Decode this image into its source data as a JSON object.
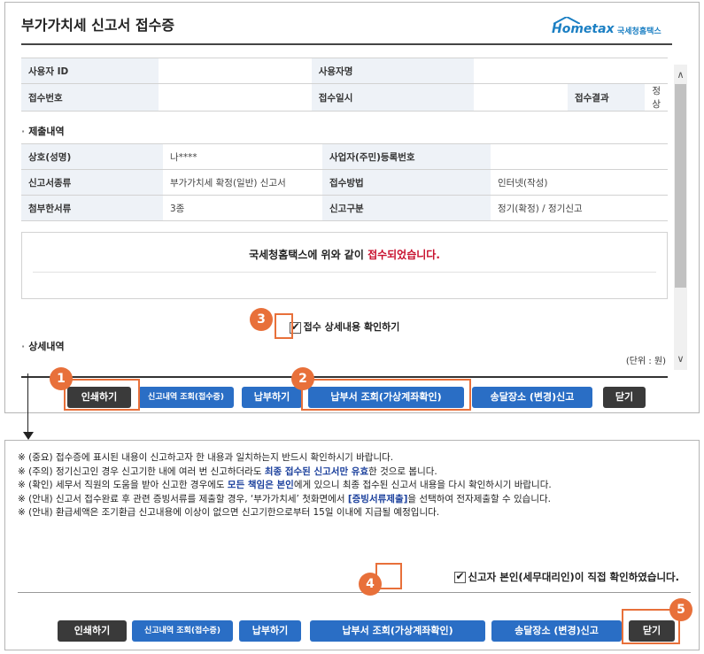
{
  "header": {
    "title": "부가가치세 신고서 접수증",
    "logo_main": "Hometax",
    "logo_sub": "국세청홈택스"
  },
  "user_table": [
    [
      {
        "t": "사용자 ID",
        "l": true
      },
      {
        "t": "",
        "l": false
      },
      {
        "t": "사용자명",
        "l": true
      },
      {
        "t": "",
        "l": false
      }
    ],
    [
      {
        "t": "접수번호",
        "l": true
      },
      {
        "t": "",
        "l": false
      },
      {
        "t": "접수일시",
        "l": true
      },
      {
        "t": "",
        "l": false
      },
      {
        "t": "접수결과",
        "l": true
      },
      {
        "t": "정상",
        "l": false
      }
    ]
  ],
  "submission": {
    "section_title": "제출내역",
    "rows": [
      [
        {
          "t": "상호(성명)",
          "l": true
        },
        {
          "t": "나****",
          "l": false
        },
        {
          "t": "사업자(주민)등록번호",
          "l": true
        },
        {
          "t": "",
          "l": false
        }
      ],
      [
        {
          "t": "신고서종류",
          "l": true
        },
        {
          "t": "부가가치세 확정(일반) 신고서",
          "l": false
        },
        {
          "t": "접수방법",
          "l": true
        },
        {
          "t": "인터넷(작성)",
          "l": false
        }
      ],
      [
        {
          "t": "첨부한서류",
          "l": true
        },
        {
          "t": "3종",
          "l": false
        },
        {
          "t": "신고구분",
          "l": true
        },
        {
          "t": "정기(확정) / 정기신고",
          "l": false
        }
      ]
    ]
  },
  "confirm": {
    "msg_prefix": "국세청홈택스에 위와 같이 ",
    "msg_red": "접수되었습니다."
  },
  "detail_check_label": "접수 상세내용 확인하기",
  "detail": {
    "section_title": "상세내역",
    "unit": "(단위 : 원)"
  },
  "buttons": [
    {
      "label": "인쇄하기",
      "style": "dark"
    },
    {
      "label": "신고내역 조회(접수증)",
      "style": "blue"
    },
    {
      "label": "납부하기",
      "style": "blue"
    },
    {
      "label": "납부서 조회(가상계좌확인)",
      "style": "blue"
    },
    {
      "label": "송달장소 (변경)신고",
      "style": "blue"
    },
    {
      "label": "닫기",
      "style": "dark"
    }
  ],
  "notes": [
    {
      "parts": [
        {
          "t": "※ (중요) 접수증에 표시된 내용이 신고하고자 한 내용과 일치하는지 반드시 확인하시기 바랍니다."
        }
      ]
    },
    {
      "parts": [
        {
          "t": "※ (주의) 정기신고인 경우 신고기한 내에 여러 번 신고하더라도 "
        },
        {
          "t": "최종 접수된 신고서만 유효",
          "b": true
        },
        {
          "t": "한 것으로 봅니다."
        }
      ]
    },
    {
      "parts": [
        {
          "t": "※ (확인) 세무서 직원의 도움을 받아 신고한 경우에도 "
        },
        {
          "t": "모든 책임은 본인",
          "b": true
        },
        {
          "t": "에게 있으니 최종 접수된 신고서 내용을 다시 확인하시기 바랍니다."
        }
      ]
    },
    {
      "parts": [
        {
          "t": "※ (안내) 신고서 접수완료 후 관련 증빙서류를 제출할 경우, ‘부가가치세’ 첫화면에서 "
        },
        {
          "t": "[증빙서류제출]",
          "b": true
        },
        {
          "t": "을 선택하여 전자제출할 수 있습니다."
        }
      ]
    },
    {
      "parts": [
        {
          "t": "※ (안내) 환급세액은 조기환급 신고내용에 이상이 없으면 신고기한으로부터 15일 이내에 지급될 예정입니다."
        }
      ]
    }
  ],
  "final_check_label": "신고자 본인(세무대리인)이 직접 확인하였습니다.",
  "badges": [
    "1",
    "2",
    "3",
    "4",
    "5"
  ],
  "colors": {
    "accent": "#e8703a",
    "primary_blue": "#2a6ec5",
    "dark_button": "#3a3a3a",
    "emphasis_red": "#c8102e"
  }
}
